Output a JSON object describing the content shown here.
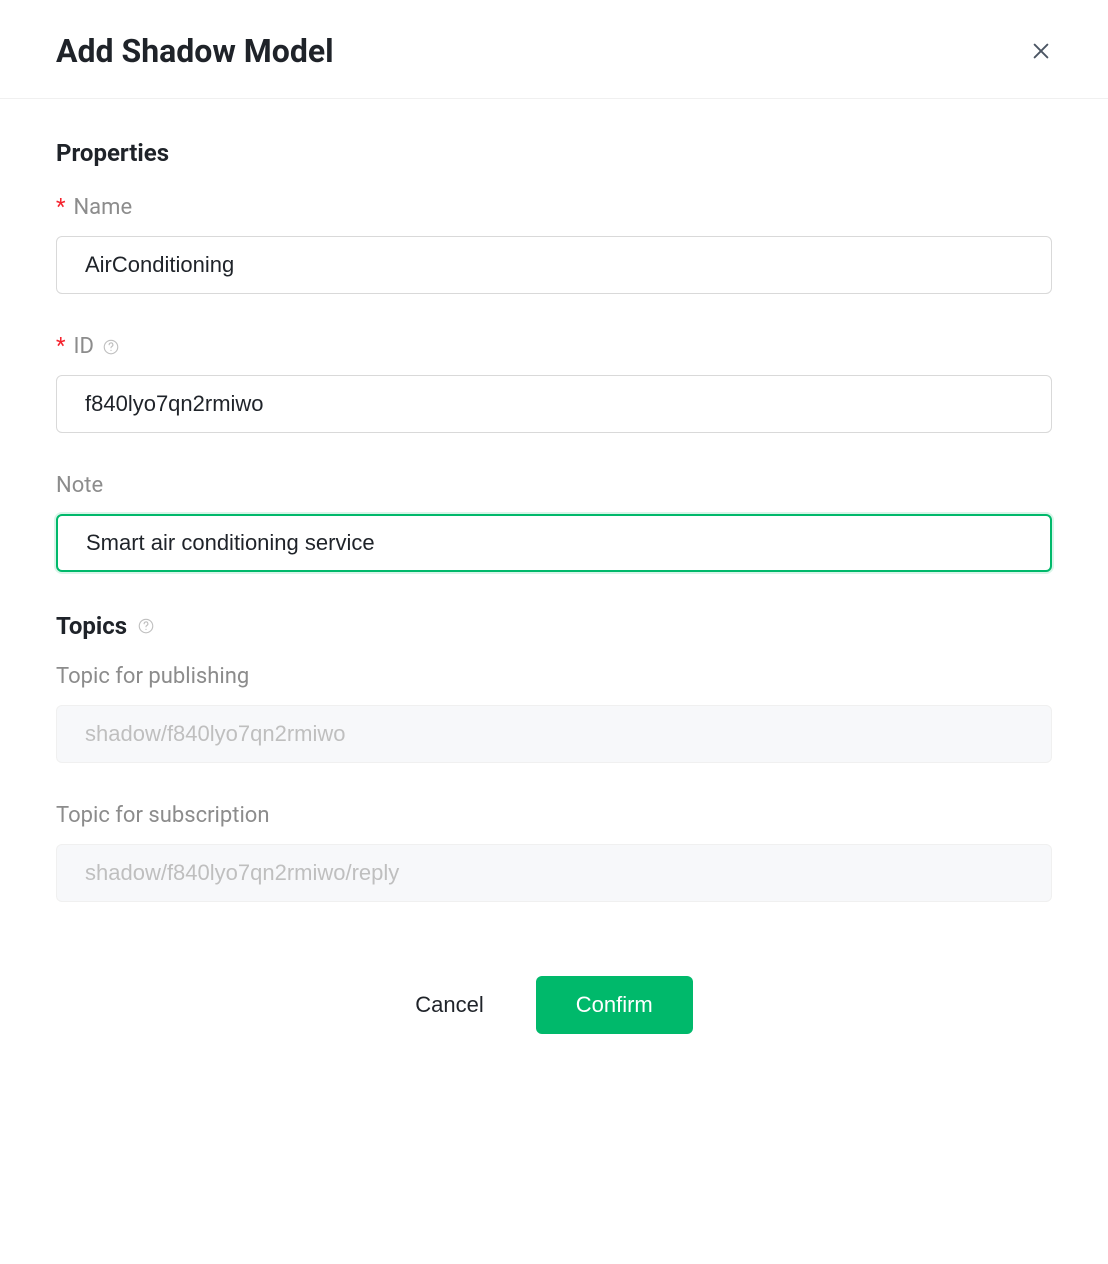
{
  "header": {
    "title": "Add Shadow Model"
  },
  "properties": {
    "heading": "Properties",
    "name_label": "Name",
    "name_value": "AirConditioning",
    "id_label": "ID",
    "id_value": "f840lyo7qn2rmiwo",
    "note_label": "Note",
    "note_value": "Smart air conditioning service"
  },
  "topics": {
    "heading": "Topics",
    "publish_label": "Topic for publishing",
    "publish_value": "shadow/f840lyo7qn2rmiwo",
    "subscribe_label": "Topic for subscription",
    "subscribe_value": "shadow/f840lyo7qn2rmiwo/reply"
  },
  "actions": {
    "cancel": "Cancel",
    "confirm": "Confirm"
  }
}
